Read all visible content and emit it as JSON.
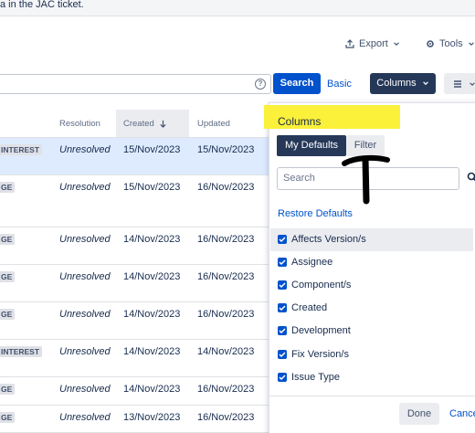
{
  "banner": {
    "text": "a in the JAC ticket."
  },
  "toolbar": {
    "export_label": "Export",
    "tools_label": "Tools"
  },
  "search": {
    "button_label": "Search",
    "basic_label": "Basic",
    "columns_label": "Columns",
    "help_glyph": "?"
  },
  "table": {
    "headers": {
      "resolution": "Resolution",
      "created": "Created",
      "updated": "Updated"
    },
    "rows": [
      {
        "lozenge": "INTEREST",
        "resolution": "Unresolved",
        "created": "15/Nov/2023",
        "updated": "15/Nov/2023"
      },
      {
        "lozenge": "GE",
        "resolution": "Unresolved",
        "created": "15/Nov/2023",
        "updated": "16/Nov/2023"
      },
      {
        "lozenge": "GE",
        "resolution": "Unresolved",
        "created": "14/Nov/2023",
        "updated": "16/Nov/2023"
      },
      {
        "lozenge": "GE",
        "resolution": "Unresolved",
        "created": "14/Nov/2023",
        "updated": "16/Nov/2023"
      },
      {
        "lozenge": "GE",
        "resolution": "Unresolved",
        "created": "14/Nov/2023",
        "updated": "16/Nov/2023"
      },
      {
        "lozenge": "INTEREST",
        "resolution": "Unresolved",
        "created": "14/Nov/2023",
        "updated": "14/Nov/2023"
      },
      {
        "lozenge": "GE",
        "resolution": "Unresolved",
        "created": "14/Nov/2023",
        "updated": "16/Nov/2023"
      },
      {
        "lozenge": "GE",
        "resolution": "Unresolved",
        "created": "13/Nov/2023",
        "updated": "16/Nov/2023"
      }
    ]
  },
  "columns_panel": {
    "title": "Columns",
    "tabs": [
      "My Defaults",
      "Filter"
    ],
    "search_placeholder": "Search",
    "restore_label": "Restore Defaults",
    "options": [
      "Affects Version/s",
      "Assignee",
      "Component/s",
      "Created",
      "Development",
      "Fix Version/s",
      "Issue Type"
    ],
    "done_label": "Done",
    "cancel_label": "Cance"
  },
  "colors": {
    "primary": "#0052cc",
    "dark": "#253858",
    "highlight": "#fbf03a",
    "selected_row": "#deebff"
  },
  "icons": [
    "export-icon",
    "gear-icon",
    "chevron-down-icon",
    "help-icon",
    "hamburger-icon",
    "sort-down-icon",
    "search-icon",
    "checkbox-checked-icon",
    "annotation-arrow-icon"
  ]
}
